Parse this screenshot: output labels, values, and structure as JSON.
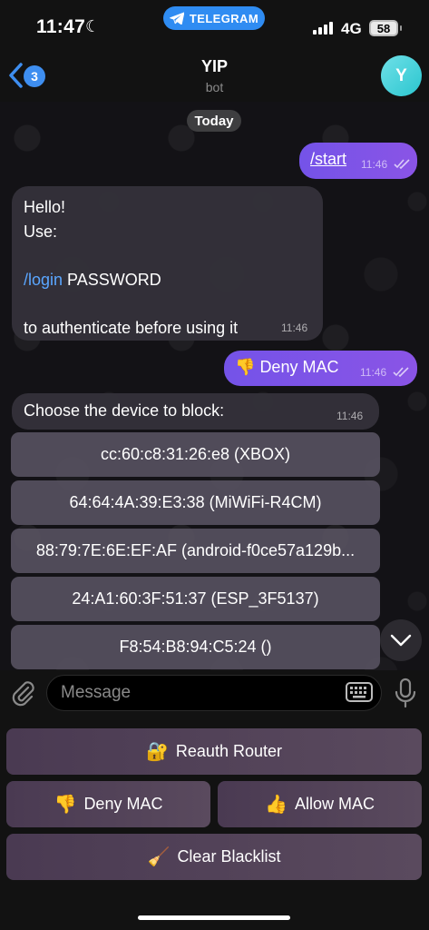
{
  "status_bar": {
    "time": "11:47",
    "telegram_label": "TELEGRAM",
    "network": "4G",
    "battery": "58"
  },
  "header": {
    "back_badge_count": "3",
    "title": "YIP",
    "subtitle": "bot",
    "avatar_letter": "Y"
  },
  "chat": {
    "date_label": "Today",
    "messages": [
      {
        "text": "/start",
        "time": "11:46"
      },
      {
        "line1": "Hello!",
        "line2": "Use:",
        "cmd": "/login",
        "cmd_rest": " PASSWORD",
        "line5": "to authenticate before using it",
        "time": "11:46"
      },
      {
        "emoji": "👎",
        "text": "Deny MAC",
        "time": "11:46"
      },
      {
        "text": "Choose the device to block:",
        "time": "11:46"
      }
    ],
    "inline_buttons": [
      "cc:60:c8:31:26:e8 (XBOX)",
      "64:64:4A:39:E3:38 (MiWiFi-R4CM)",
      "88:79:7E:6E:EF:AF (android-f0ce57a129b...",
      "24:A1:60:3F:51:37 (ESP_3F5137)",
      "F8:54:B8:94:C5:24 ()"
    ]
  },
  "composer": {
    "placeholder": "Message"
  },
  "reply_keyboard": [
    {
      "emoji": "🔐",
      "label": "Reauth Router"
    },
    {
      "emoji": "👎",
      "label": "Deny MAC"
    },
    {
      "emoji": "👍",
      "label": "Allow MAC"
    },
    {
      "emoji": "🧹",
      "label": "Clear Blacklist"
    }
  ],
  "colors": {
    "accent": "#3e8ef0",
    "outgoing_bubble": "#7c54e8",
    "link": "#5aa6ff",
    "telegram_pill": "#2f8cf2"
  }
}
